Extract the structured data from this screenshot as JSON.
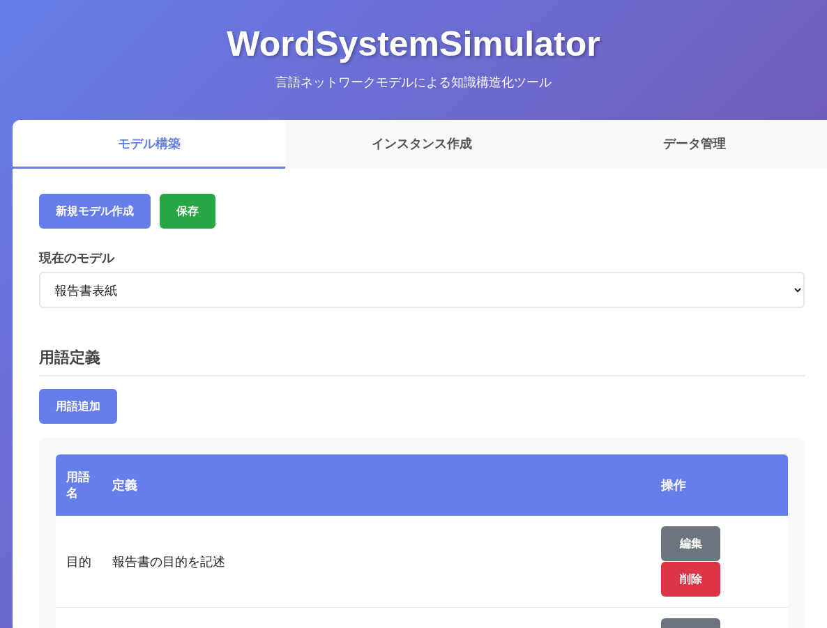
{
  "header": {
    "title": "WordSystemSimulator",
    "subtitle": "言語ネットワークモデルによる知識構造化ツール"
  },
  "tabs": [
    {
      "label": "モデル構築",
      "selected": true
    },
    {
      "label": "インスタンス作成",
      "selected": false
    },
    {
      "label": "データ管理",
      "selected": false
    }
  ],
  "toolbar": [
    {
      "label": "新規モデル作成",
      "kind": "primary"
    },
    {
      "label": "保存",
      "kind": "success"
    }
  ],
  "model_select": {
    "label": "現在のモデル",
    "value": "報告書表紙"
  },
  "terms": {
    "title": "用語定義",
    "add_button": "用語追加",
    "columns": [
      "用語名",
      "定義",
      "操作"
    ],
    "rows": [
      {
        "name": "目的",
        "definition": "報告書の目的を記述",
        "actions": [
          "編集",
          "削除"
        ]
      },
      {
        "kind": "partial"
      }
    ]
  }
}
